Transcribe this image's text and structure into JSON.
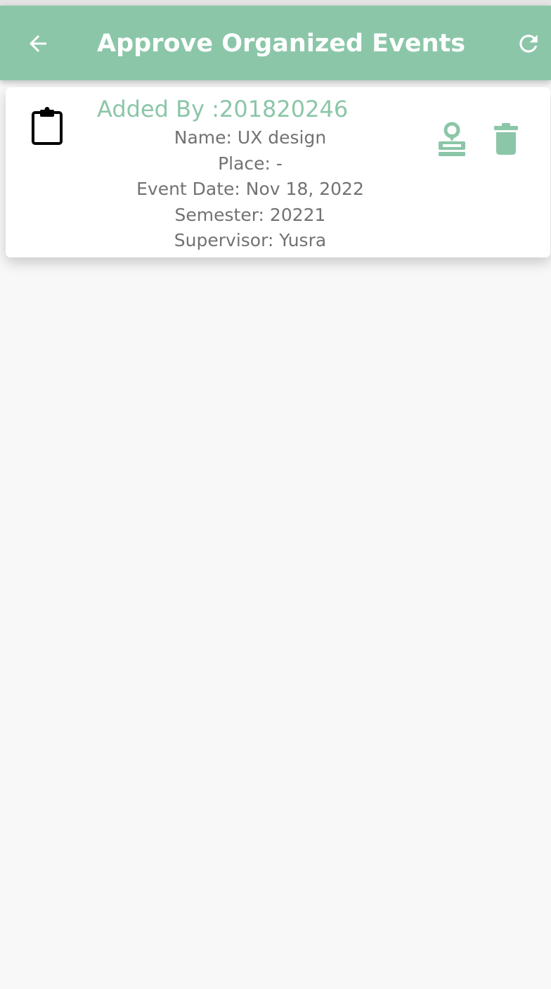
{
  "status_bar": {},
  "app_bar": {
    "title": "Approve Organized Events",
    "back_icon": "arrow-back-icon",
    "refresh_icon": "refresh-icon",
    "background_color": "#8bc6a8",
    "foreground_color": "#ffffff"
  },
  "events": [
    {
      "added_by": "Added By :201820246",
      "name": "Name: UX design",
      "place": "Place: -",
      "event_date": "Event Date: Nov 18, 2022",
      "semester": "Semester: 20221",
      "supervisor": "Supervisor: Yusra",
      "leading_icon": "clipboard-icon",
      "approve_icon": "stamp-icon",
      "delete_icon": "trash-icon"
    }
  ],
  "colors": {
    "accent": "#8bc6a8",
    "detail_text": "#727272",
    "page_background": "#f8f8f8",
    "card_background": "#ffffff"
  }
}
